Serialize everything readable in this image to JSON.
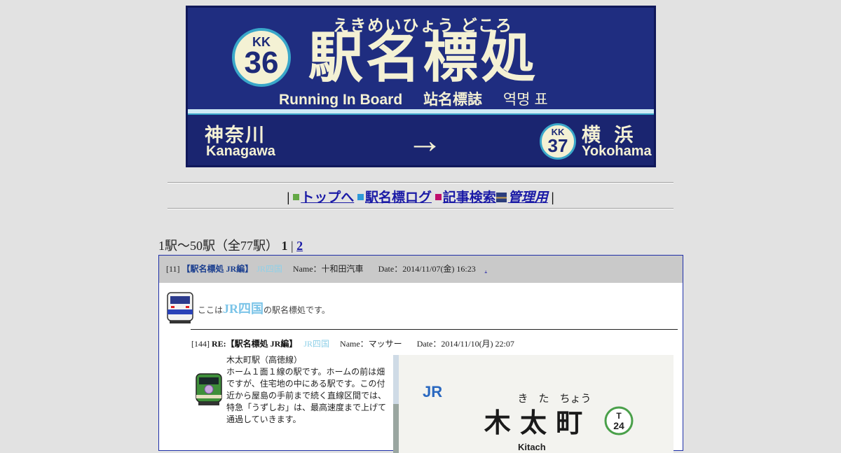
{
  "banner": {
    "kana": "えきめいひょう どころ",
    "line_code": "KK",
    "station_number": "36",
    "title_kanji": "駅名標処",
    "subtitle_en": "Running In Board",
    "subtitle_zh": "站名標誌",
    "subtitle_ko": "역명 표",
    "prev_station_jp": "神奈川",
    "prev_station_en": "Kanagawa",
    "arrow": "→",
    "next_line_code": "KK",
    "next_station_number": "37",
    "next_station_jp": "横 浜",
    "next_station_en": "Yokohama",
    "colors": {
      "background": "#1d2a78",
      "text": "#f4f1d4",
      "accent": "#3aa7c9"
    }
  },
  "nav": {
    "sep": "|",
    "items": [
      {
        "label": "トップへ",
        "icon": "green-square-icon"
      },
      {
        "label": "駅名標ログ",
        "icon": "blue-square-icon"
      },
      {
        "label": "記事検索",
        "icon": "magenta-square-icon"
      },
      {
        "label": "管理用",
        "icon": "admin-icon"
      }
    ]
  },
  "pager": {
    "summary": "1駅～50駅（全77駅）",
    "current": "1",
    "sep": "|",
    "next_page": "2"
  },
  "post": {
    "number": "[11]",
    "title": "【駅名標処 JR編】",
    "category": "JR四国",
    "name_label": "Name：十和田汽車",
    "date_label": "Date：2014/11/07(金) 16:23",
    "link": ".",
    "lead_pre": "ここは",
    "lead_big": "JR四国",
    "lead_post": "の駅名標処です。",
    "reply": {
      "number": "[144]",
      "title": "RE:【駅名標処 JR編】",
      "category": "JR四国",
      "name_label": "Name：マッサー",
      "date_label": "Date：2014/11/10(月) 22:07",
      "body_title": "木太町駅（高徳線）",
      "body": "ホーム１面１線の駅です。ホームの前は畑ですが、住宅地の中にある駅です。この付近から屋島の手前まで続く直線区間では、特急「うずしお」は、最高速度まで上げて通過していきます。",
      "photo": {
        "logo": "JR",
        "kana": "き　た　ちょう",
        "name": "木 太 町",
        "line_code": "T",
        "number": "24",
        "romaji": "Kitach"
      }
    }
  }
}
